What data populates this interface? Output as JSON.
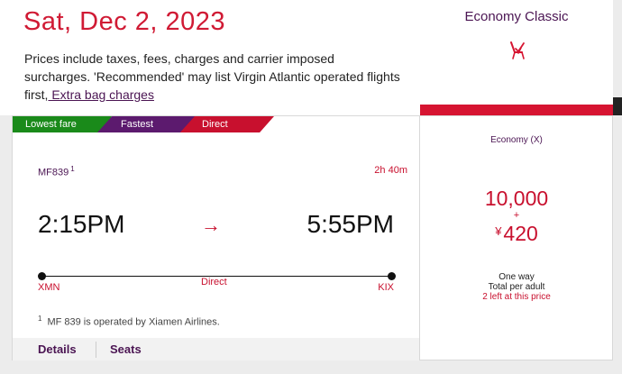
{
  "header": {
    "date": "Sat, Dec 2, 2023",
    "description": "Prices include taxes, fees, charges and carrier imposed surcharges. 'Recommended' may list Virgin Atlantic operated flights first,",
    "link_label": " Extra bag charges"
  },
  "cabin": {
    "title": "Economy Classic",
    "icon": "seat-icon",
    "accent_color": "#d61431"
  },
  "badges": {
    "lowest": "Lowest fare",
    "fastest": "Fastest",
    "direct": "Direct"
  },
  "flight": {
    "number": "MF839",
    "footnote_mark": "1",
    "duration": "2h 40m",
    "departure_time": "2:15PM",
    "arrival_time": "5:55PM",
    "arrow": "→",
    "origin": "XMN",
    "destination": "KIX",
    "stops": "Direct",
    "note": "MF 839 is operated by Xiamen Airlines."
  },
  "tabs": {
    "details": "Details",
    "seats": "Seats"
  },
  "fare": {
    "class_label": "Economy (X)",
    "points": "10,000",
    "plus": "+",
    "currency": "¥",
    "tax": "420",
    "trip_type": "One way",
    "per": "Total per adult",
    "availability": "2 left at this price"
  }
}
